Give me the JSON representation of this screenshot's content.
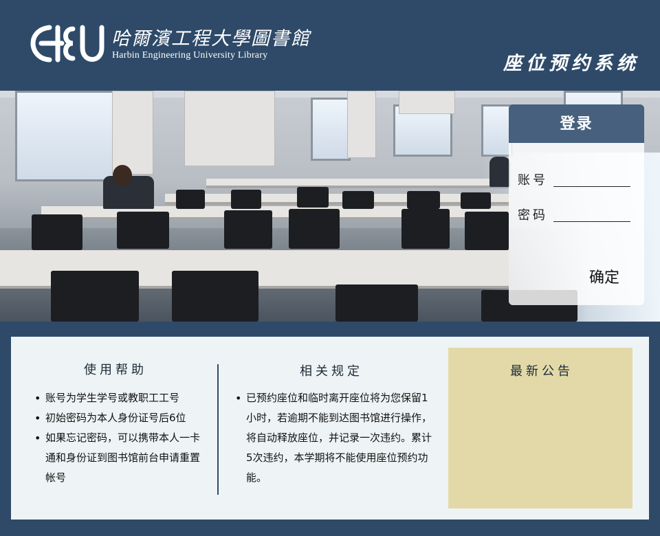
{
  "header": {
    "logo_cn": "哈爾濱工程大學圖書館",
    "logo_en": "Harbin Engineering University Library",
    "system_title": "座位预约系统"
  },
  "login": {
    "title": "登录",
    "account_label": "账号",
    "password_label": "密码",
    "account_value": "",
    "password_value": "",
    "confirm_label": "确定"
  },
  "help": {
    "title": "使用帮助",
    "items": [
      "账号为学生学号或教职工工号",
      "初始密码为本人身份证号后6位",
      "如果忘记密码，可以携带本人一卡通和身份证到图书馆前台申请重置帐号"
    ]
  },
  "rules": {
    "title": "相关规定",
    "items": [
      "已预约座位和临时离开座位将为您保留1小时，若逾期不能到达图书馆进行操作，将自动释放座位，并记录一次违约。累计5次违约，本学期将不能使用座位预约功能。"
    ]
  },
  "notice": {
    "title": "最新公告"
  },
  "colors": {
    "brand_navy": "#2e4a68",
    "login_header": "#46607d",
    "notice_bg": "#e3d9a8",
    "info_bg": "#eef4f5"
  }
}
